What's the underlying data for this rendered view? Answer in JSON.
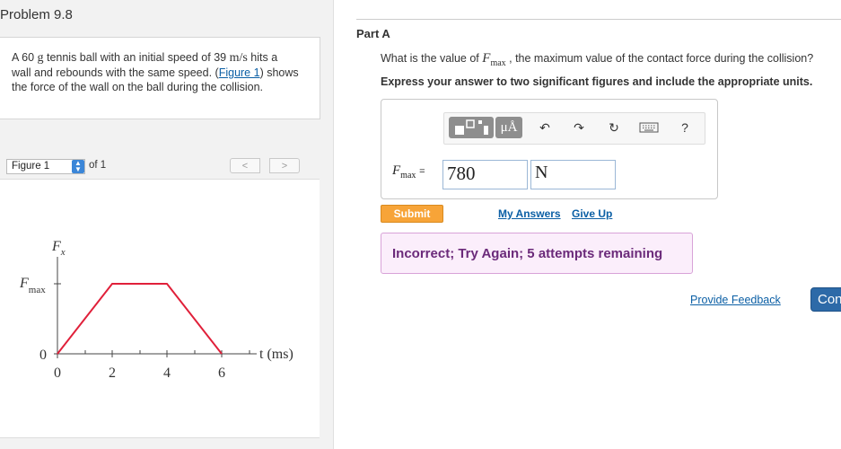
{
  "problem": {
    "title": "Problem 9.8",
    "text_part1": "A 60 ",
    "mass_unit": "g",
    "text_part2": " tennis ball with an initial speed of 39 ",
    "speed_unit": "m/s",
    "text_part3": " hits a wall and rebounds with the same speed. (",
    "figure_link": "Figure 1",
    "text_part4": ") shows the force of the wall on the ball during the collision."
  },
  "figure_nav": {
    "select_value": "Figure 1",
    "of_text": "of 1",
    "prev_icon": "chevron-left-icon",
    "next_icon": "chevron-right-icon"
  },
  "figure": {
    "y_axis_label": "F",
    "y_axis_subscript": "x",
    "fmax_label": "F",
    "fmax_subscript": "max",
    "zero_label": "0",
    "x_axis_label": "t (ms)",
    "x_ticks": [
      "0",
      "2",
      "4",
      "6"
    ],
    "line_color": "#e0203a"
  },
  "part": {
    "label": "Part A",
    "question_pre": "What is the value of ",
    "question_var": "F",
    "question_sub": "max",
    "question_post": " , the maximum value of the contact force during the collision?",
    "instructions": "Express your answer to two significant figures and include the appropriate units."
  },
  "toolbar": {
    "units_label": "μÅ",
    "help_label": "?"
  },
  "answer": {
    "var_name": "F",
    "var_sub": "max",
    "equals": "=",
    "value": "780",
    "unit": "N"
  },
  "actions": {
    "submit": "Submit",
    "my_answers": "My Answers",
    "give_up": "Give Up"
  },
  "feedback": {
    "text": "Incorrect; Try Again; 5 attempts remaining",
    "bg_color": "#fbeefb",
    "text_color": "#6b2a7a"
  },
  "footer": {
    "provide_feedback": "Provide Feedback",
    "continue": "Continue"
  }
}
